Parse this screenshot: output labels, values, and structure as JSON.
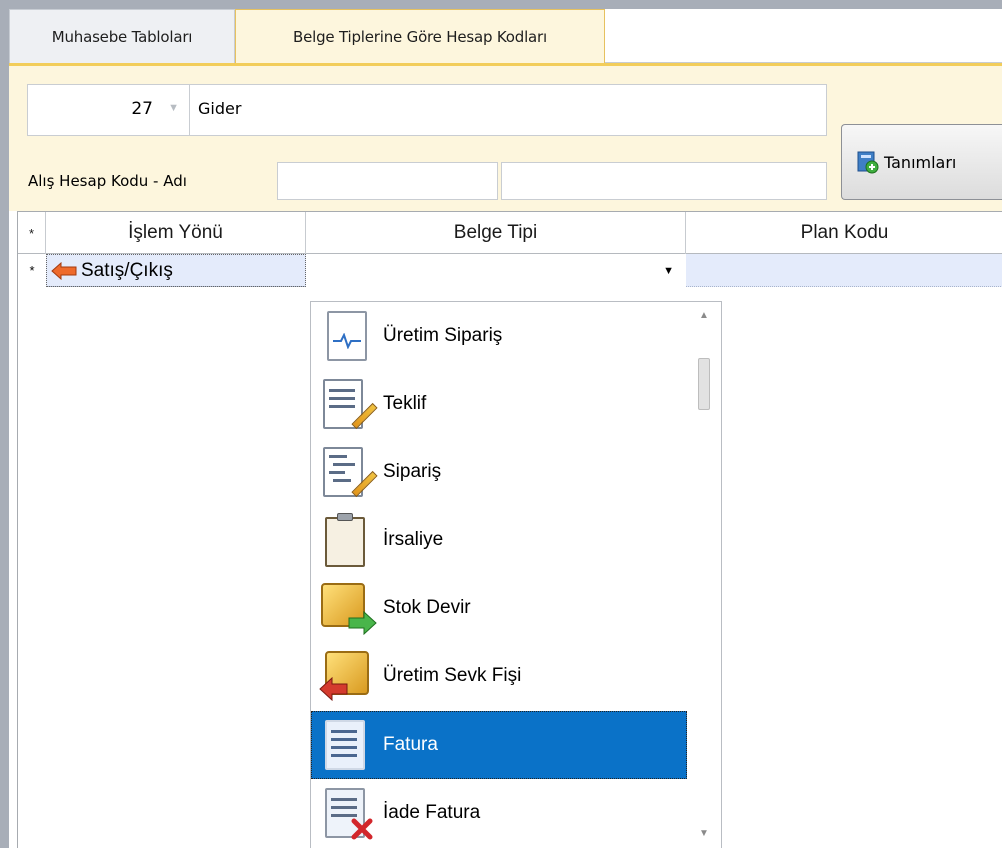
{
  "tabs": [
    {
      "label": "Muhasebe Tabloları",
      "active": false
    },
    {
      "label": "Belge Tiplerine Göre Hesap Kodları",
      "active": true
    }
  ],
  "form": {
    "number_value": "27",
    "name_value": "Gider",
    "account_label": "Alış Hesap Kodu - Adı",
    "account_code_value": "",
    "account_name_value": "",
    "definitions_button_label": "Tanımları"
  },
  "grid": {
    "indicator_symbol": "*",
    "columns": [
      "İşlem Yönü",
      "Belge Tipi",
      "Plan Kodu"
    ],
    "row": {
      "islem_yonu": "Satış/Çıkış",
      "belge_tipi": "",
      "plan_kodu": ""
    }
  },
  "dropdown": {
    "items": [
      {
        "label": "Üretim Sipariş",
        "icon": "production-order-icon"
      },
      {
        "label": "Teklif",
        "icon": "quote-icon"
      },
      {
        "label": "Sipariş",
        "icon": "order-icon"
      },
      {
        "label": "İrsaliye",
        "icon": "waybill-icon"
      },
      {
        "label": "Stok Devir",
        "icon": "stock-transfer-icon"
      },
      {
        "label": "Üretim Sevk Fişi",
        "icon": "production-dispatch-icon"
      },
      {
        "label": "Fatura",
        "icon": "invoice-icon"
      },
      {
        "label": "İade Fatura",
        "icon": "return-invoice-icon"
      }
    ],
    "selected": "Fatura"
  },
  "colors": {
    "selection": "#0a72c8",
    "panel": "#fdf6dd",
    "tab_accent": "#f2cd5a",
    "row_highlight": "#e4ebfb"
  }
}
